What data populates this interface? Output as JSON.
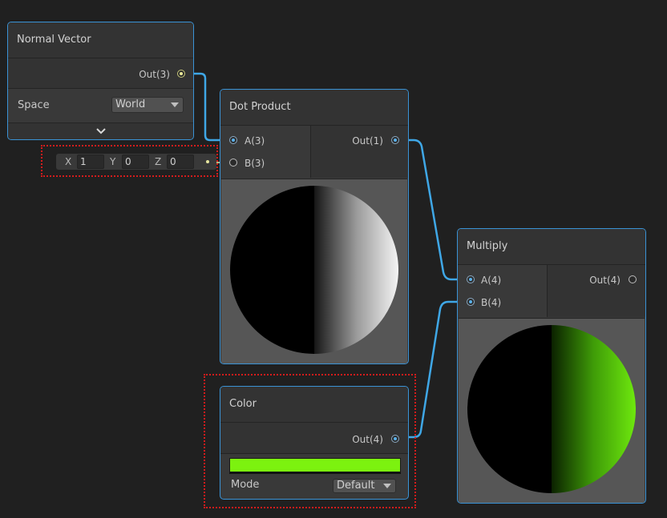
{
  "nodes": {
    "normal_vector": {
      "title": "Normal Vector",
      "out_label": "Out(3)",
      "space_label": "Space",
      "space_value": "World"
    },
    "dot_product": {
      "title": "Dot Product",
      "in_a": "A(3)",
      "in_b": "B(3)",
      "out_label": "Out(1)"
    },
    "multiply": {
      "title": "Multiply",
      "in_a": "A(4)",
      "in_b": "B(4)",
      "out_label": "Out(4)"
    },
    "color": {
      "title": "Color",
      "out_label": "Out(4)",
      "swatch_color": "#7cf20f",
      "mode_label": "Mode",
      "mode_value": "Default"
    }
  },
  "vector_input": {
    "x_label": "X",
    "x_value": "1",
    "y_label": "Y",
    "y_value": "0",
    "z_label": "Z",
    "z_value": "0"
  },
  "colors": {
    "wire": "#3fa7e6",
    "wire_yellow": "#e6e6a0",
    "node_border": "#3a93d6",
    "highlight": "#d41c1c",
    "background": "#202020"
  }
}
